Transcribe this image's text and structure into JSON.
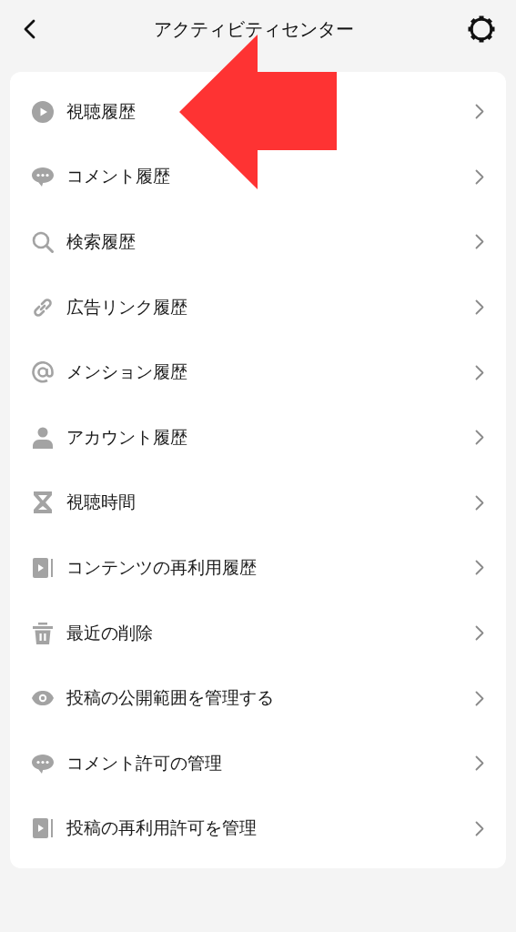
{
  "header": {
    "title": "アクティビティセンター"
  },
  "menu_items": [
    {
      "kind": "play",
      "label": "視聴履歴"
    },
    {
      "kind": "comment",
      "label": "コメント履歴"
    },
    {
      "kind": "search",
      "label": "検索履歴"
    },
    {
      "kind": "link",
      "label": "広告リンク履歴"
    },
    {
      "kind": "mention",
      "label": "メンション履歴"
    },
    {
      "kind": "person",
      "label": "アカウント履歴"
    },
    {
      "kind": "hourglass",
      "label": "視聴時間"
    },
    {
      "kind": "reuse",
      "label": "コンテンツの再利用履歴"
    },
    {
      "kind": "trash",
      "label": "最近の削除"
    },
    {
      "kind": "eye",
      "label": "投稿の公開範囲を管理する"
    },
    {
      "kind": "comment",
      "label": "コメント許可の管理"
    },
    {
      "kind": "reuse",
      "label": "投稿の再利用許可を管理"
    }
  ]
}
